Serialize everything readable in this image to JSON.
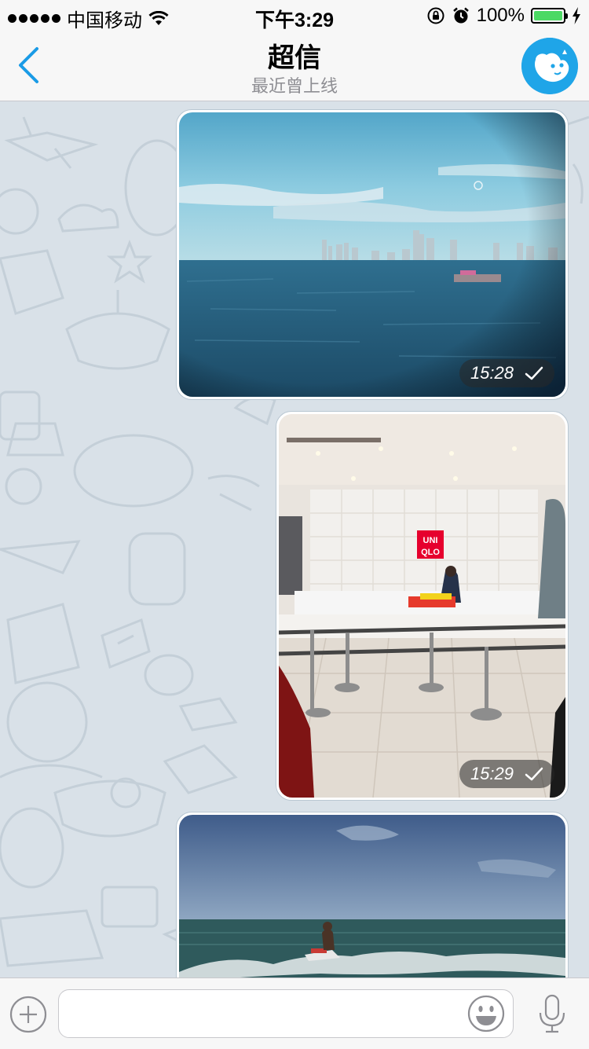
{
  "status_bar": {
    "carrier": "中国移动",
    "time": "下午3:29",
    "battery_percent": "100%",
    "battery_level": 1.0,
    "icons": [
      "signal-dots-icon",
      "wifi-icon",
      "orientation-lock-icon",
      "alarm-icon",
      "battery-icon",
      "charging-bolt-icon"
    ]
  },
  "nav": {
    "title": "超信",
    "subtitle": "最近曾上线",
    "back_icon": "chevron-left-icon",
    "avatar_icon": "bot-face-avatar"
  },
  "messages": [
    {
      "type": "photo",
      "subject": "sea-city-skyline",
      "time": "15:28",
      "status": "sent"
    },
    {
      "type": "photo",
      "subject": "uniqlo-store",
      "time": "15:29",
      "status": "sent",
      "photo_text": "UNI QLO"
    },
    {
      "type": "photo",
      "subject": "jet-ski-sea",
      "time": "",
      "status": ""
    }
  ],
  "input_bar": {
    "placeholder": "",
    "value": "",
    "icons": [
      "plus-circle-icon",
      "emoji-icon",
      "microphone-icon"
    ]
  },
  "colors": {
    "accent": "#1a9be6",
    "chat_background": "#d9e1e8",
    "battery_green": "#4cd964"
  }
}
